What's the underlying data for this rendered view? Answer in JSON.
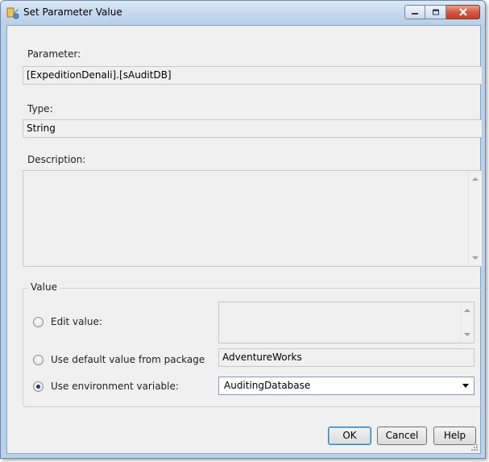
{
  "window": {
    "title": "Set Parameter Value"
  },
  "parameter": {
    "label": "Parameter:",
    "value": "[ExpeditionDenali].[sAuditDB]"
  },
  "type": {
    "label": "Type:",
    "value": "String"
  },
  "description": {
    "label": "Description:",
    "value": ""
  },
  "value_group": {
    "title": "Value",
    "edit_value_label": "Edit value:",
    "edit_value_text": "",
    "default_label": "Use default value from package",
    "default_value": "AdventureWorks",
    "env_label": "Use environment variable:",
    "env_selected": "AuditingDatabase",
    "selected_option": "environment"
  },
  "buttons": {
    "ok": "OK",
    "cancel": "Cancel",
    "help": "Help"
  },
  "icons": {
    "app": "parameter-wizard-icon",
    "minimize": "minimize-icon",
    "maximize": "maximize-icon",
    "close": "close-icon"
  },
  "colors": {
    "titlebar": "#c5d8ee",
    "close_button": "#c44128",
    "default_button_border": "#3c7fb1"
  }
}
